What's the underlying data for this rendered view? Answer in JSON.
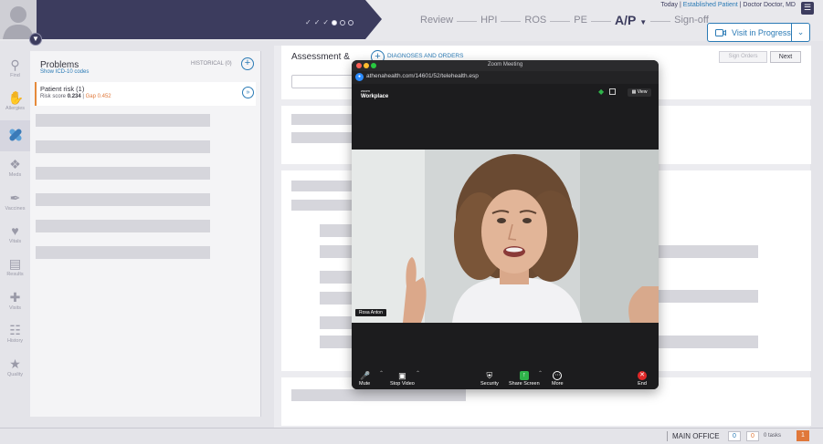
{
  "header": {
    "user": {
      "date": "Today",
      "separator": "|",
      "patient_status": "Established Patient",
      "doctor": "Doctor Doctor, MD"
    },
    "nav_tabs": [
      "Review",
      "HPI",
      "ROS",
      "PE",
      "A/P",
      "Sign-off"
    ],
    "active_tab": "A/P",
    "visit_button": "Visit in Progress"
  },
  "sidebar": {
    "items": [
      {
        "label": "Find",
        "icon": "search-icon"
      },
      {
        "label": "Allergies",
        "icon": "hand-icon"
      },
      {
        "label": "",
        "icon": "bandage-icon"
      },
      {
        "label": "Meds",
        "icon": "pills-icon"
      },
      {
        "label": "Vaccines",
        "icon": "syringe-icon"
      },
      {
        "label": "Vitals",
        "icon": "heart-pulse-icon"
      },
      {
        "label": "Results",
        "icon": "results-icon"
      },
      {
        "label": "Visits",
        "icon": "medkit-icon"
      },
      {
        "label": "History",
        "icon": "clipboard-icon"
      },
      {
        "label": "Quality",
        "icon": "star-icon"
      }
    ]
  },
  "problems": {
    "title": "Problems",
    "link": "Show ICD-10 codes",
    "historical": "HISTORICAL (0)",
    "risk": {
      "title": "Patient risk (1)",
      "risk_label": "Risk score",
      "risk_value": "0.234",
      "sep": "|",
      "gap_label": "Gap",
      "gap_value": "0.452"
    }
  },
  "assessment": {
    "title": "Assessment &",
    "diagnoses_link": "DIAGNOSES AND ORDERS",
    "sign_orders": "Sign Orders",
    "next": "Next"
  },
  "zoom": {
    "window_title": "Zoom Meeting",
    "url": "athenahealth.com/14601/52/telehealth.esp",
    "logo_top": "zoom",
    "logo_bottom": "Workplace",
    "view": "View",
    "participant": "Rosa Anton",
    "controls": [
      {
        "label": "Mute",
        "icon": "microphone-icon"
      },
      {
        "label": "Stop Video",
        "icon": "camera-icon"
      },
      {
        "label": "Security",
        "icon": "shield-icon"
      },
      {
        "label": "Share Screen",
        "icon": "share-screen-icon"
      },
      {
        "label": "More",
        "icon": "more-icon"
      },
      {
        "label": "End",
        "icon": "end-call-icon"
      }
    ]
  },
  "footer": {
    "office": "MAIN OFFICE",
    "count_a": "0",
    "count_b": "0",
    "tasks": "0 tasks",
    "alerts": "1"
  },
  "colors": {
    "navy": "#3c3c5e",
    "link_blue": "#2a7ab5",
    "warning_orange": "#e0783a",
    "zoom_green": "#2fb34a",
    "zoom_end_red": "#e02828"
  }
}
